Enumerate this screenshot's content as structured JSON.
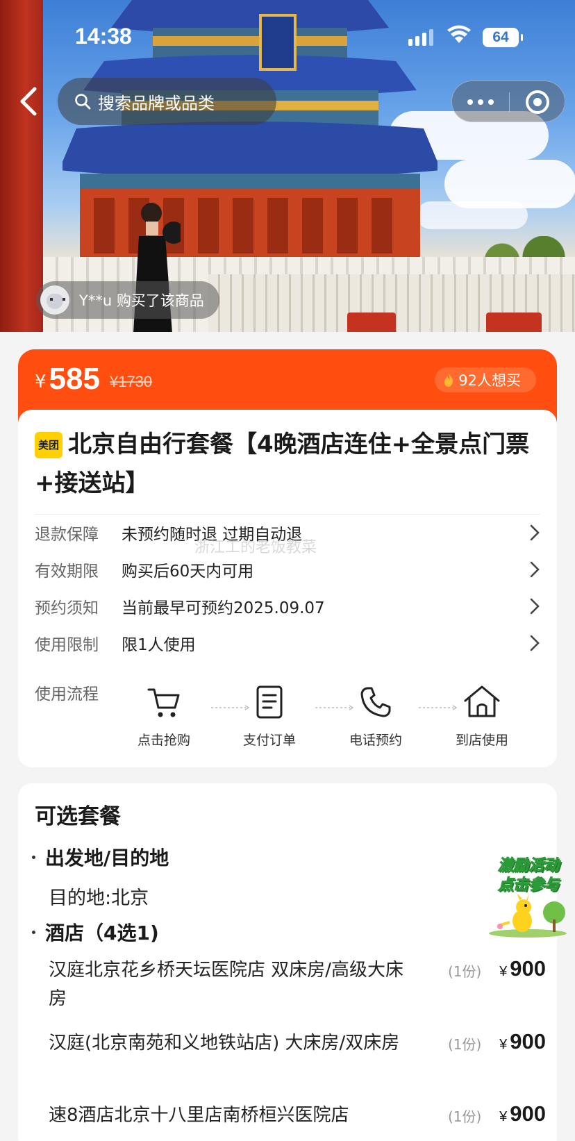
{
  "status_bar": {
    "time": "14:38",
    "battery": "64"
  },
  "search": {
    "placeholder": "搜索品牌或品类"
  },
  "purchase_toast": {
    "text": "Y**u 购买了该商品"
  },
  "price": {
    "currency": "¥",
    "current": "585",
    "original": "¥1730",
    "want_count": "92人想买"
  },
  "product": {
    "brand_logo": "美团",
    "title": "北京自由行套餐【4晚酒店连住+全景点门票+接送站】"
  },
  "info_rows": [
    {
      "label": "退款保障",
      "value": "未预约随时退 过期自动退"
    },
    {
      "label": "有效期限",
      "value": "购买后60天内可用"
    },
    {
      "label": "预约须知",
      "value": "当前最早可预约2025.09.07"
    },
    {
      "label": "使用限制",
      "value": "限1人使用"
    }
  ],
  "usage_flow": {
    "label": "使用流程",
    "steps": [
      {
        "label": "点击抢购",
        "icon": "cart-icon"
      },
      {
        "label": "支付订单",
        "icon": "document-icon"
      },
      {
        "label": "电话预约",
        "icon": "phone-icon"
      },
      {
        "label": "到店使用",
        "icon": "home-icon"
      }
    ]
  },
  "watermark": "浙江工的老饭教菜",
  "packages": {
    "title": "可选套餐",
    "origin_section": {
      "heading": "出发地/目的地",
      "value": "目的地:北京"
    },
    "hotel_section": {
      "heading": "酒店（4选1)",
      "items": [
        {
          "name": "汉庭北京花乡桥天坛医院店 双床房/高级大床房",
          "qty": "(1份)",
          "currency": "¥",
          "price": "900"
        },
        {
          "name": "汉庭(北京南苑和义地铁站店) 大床房/双床房",
          "qty": "(1份)",
          "currency": "¥",
          "price": "900"
        },
        {
          "name": "速8酒店北京十八里店南桥桓兴医院店",
          "qty": "(1份)",
          "currency": "¥",
          "price": "900"
        }
      ]
    }
  },
  "promo_badge": {
    "line1": "激励活动",
    "line2": "点击参与"
  },
  "colors": {
    "accent": "#ff4e0f",
    "brand_yellow": "#ffd100"
  }
}
